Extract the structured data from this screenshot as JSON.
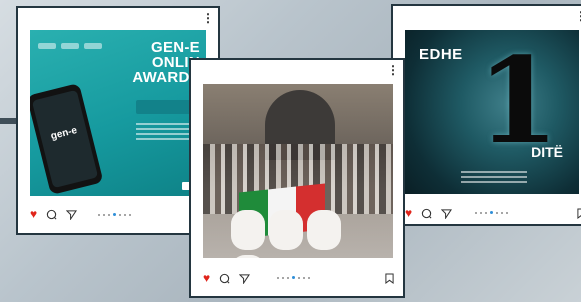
{
  "posts": [
    {
      "id_label": "left",
      "menu_icon": "more-vertical-icon",
      "poster": {
        "title_lines": [
          "GEN-E",
          "ONLIN",
          "AWARDS"
        ],
        "phone_text": "gen-e"
      },
      "actions": {
        "like": "heart-icon",
        "comment": "comment-icon",
        "share": "send-icon"
      },
      "carousel": {
        "total": 7,
        "active": 3
      }
    },
    {
      "id_label": "middle",
      "menu_icon": "more-vertical-icon",
      "actions": {
        "like": "heart-icon",
        "comment": "comment-icon",
        "share": "send-icon",
        "save": "bookmark-icon"
      },
      "carousel": {
        "total": 7,
        "active": 3
      },
      "flag_colors": [
        "#1f8b3a",
        "#f4f4f4",
        "#d42f2f"
      ]
    },
    {
      "id_label": "right",
      "menu_icon": "more-vertical-icon",
      "poster": {
        "word_top": "EDHE",
        "digit": "1",
        "word_bottom": "DITË"
      },
      "actions": {
        "like": "heart-icon",
        "comment": "comment-icon",
        "share": "send-icon",
        "save": "bookmark-icon"
      },
      "carousel": {
        "total": 7,
        "active": 3
      }
    }
  ],
  "colors": {
    "like": "#e0251b",
    "carousel_active": "#2f8fd8",
    "card_border": "#243640"
  }
}
